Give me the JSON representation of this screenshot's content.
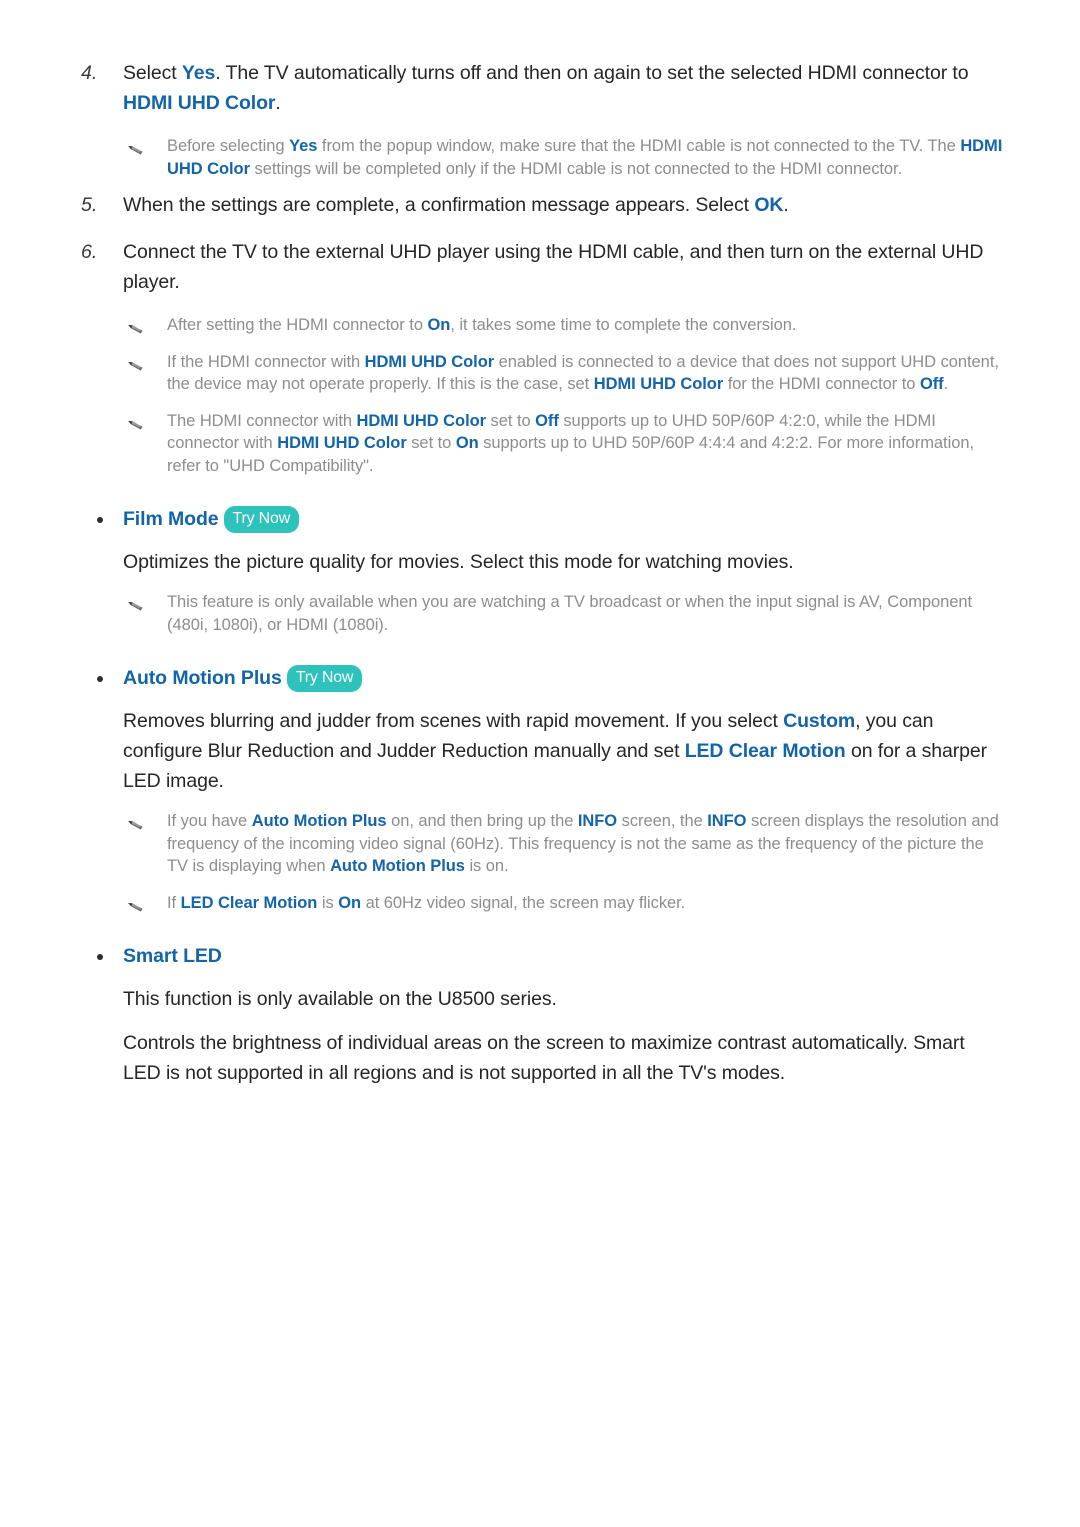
{
  "colors": {
    "link_blue": "#1464aa",
    "note_gray": "#8d8d8d",
    "body_dark": "#262626",
    "try_now_teal": "#2ec2bd"
  },
  "steps": [
    {
      "number": "4.",
      "segments": [
        {
          "t": "Select ",
          "s": "plain"
        },
        {
          "t": "Yes",
          "s": "link"
        },
        {
          "t": ". The TV automatically turns off and then on again to set the selected HDMI connector to ",
          "s": "plain"
        },
        {
          "t": "HDMI UHD Color",
          "s": "link"
        },
        {
          "t": ".",
          "s": "plain"
        }
      ],
      "notes": [
        {
          "icon": "pencil-icon",
          "segments": [
            {
              "t": "Before selecting ",
              "s": "plain"
            },
            {
              "t": "Yes",
              "s": "link"
            },
            {
              "t": " from the popup window, make sure that the HDMI cable is not connected to the TV. The ",
              "s": "plain"
            },
            {
              "t": "HDMI UHD Color",
              "s": "link"
            },
            {
              "t": " settings will be completed only if the HDMI cable is not connected to the HDMI connector.",
              "s": "plain"
            }
          ]
        }
      ]
    },
    {
      "number": "5.",
      "segments": [
        {
          "t": "When the settings are complete, a confirmation message appears. Select ",
          "s": "plain"
        },
        {
          "t": "OK",
          "s": "link"
        },
        {
          "t": ".",
          "s": "plain"
        }
      ],
      "notes": []
    },
    {
      "number": "6.",
      "segments": [
        {
          "t": "Connect the TV to the external UHD player using the HDMI cable, and then turn on the external UHD player.",
          "s": "plain"
        }
      ],
      "notes": [
        {
          "icon": "pencil-icon",
          "segments": [
            {
              "t": "After setting the HDMI connector to ",
              "s": "plain"
            },
            {
              "t": "On",
              "s": "link"
            },
            {
              "t": ", it takes some time to complete the conversion.",
              "s": "plain"
            }
          ]
        },
        {
          "icon": "pencil-icon",
          "segments": [
            {
              "t": "If the HDMI connector with ",
              "s": "plain"
            },
            {
              "t": "HDMI UHD Color",
              "s": "link"
            },
            {
              "t": " enabled is connected to a device that does not support UHD content, the device may not operate properly. If this is the case, set ",
              "s": "plain"
            },
            {
              "t": "HDMI UHD Color",
              "s": "link"
            },
            {
              "t": " for the HDMI connector to ",
              "s": "plain"
            },
            {
              "t": "Off",
              "s": "link"
            },
            {
              "t": ".",
              "s": "plain"
            }
          ]
        },
        {
          "icon": "pencil-icon",
          "segments": [
            {
              "t": "The HDMI connector with ",
              "s": "plain"
            },
            {
              "t": "HDMI UHD Color",
              "s": "link"
            },
            {
              "t": " set to ",
              "s": "plain"
            },
            {
              "t": "Off",
              "s": "link"
            },
            {
              "t": " supports up to UHD 50P/60P 4:2:0, while the HDMI connector with ",
              "s": "plain"
            },
            {
              "t": "HDMI UHD Color",
              "s": "link"
            },
            {
              "t": " set to ",
              "s": "plain"
            },
            {
              "t": "On",
              "s": "link"
            },
            {
              "t": " supports up to UHD 50P/60P 4:4:4 and 4:2:2. For more information, refer to \"UHD Compatibility\".",
              "s": "plain"
            }
          ]
        }
      ]
    }
  ],
  "sections": [
    {
      "title": "Film Mode",
      "badge": "Try Now",
      "has_badge": true,
      "blocks": [
        {
          "kind": "para",
          "segments": [
            {
              "t": "Optimizes the picture quality for movies. Select this mode for watching movies.",
              "s": "plain"
            }
          ]
        },
        {
          "kind": "note",
          "icon": "pencil-icon",
          "segments": [
            {
              "t": "This feature is only available when you are watching a TV broadcast or when the input signal is AV, Component (480i, 1080i), or HDMI (1080i).",
              "s": "plain"
            }
          ]
        }
      ]
    },
    {
      "title": "Auto Motion Plus",
      "badge": "Try Now",
      "has_badge": true,
      "blocks": [
        {
          "kind": "para",
          "segments": [
            {
              "t": "Removes blurring and judder from scenes with rapid movement. If you select ",
              "s": "plain"
            },
            {
              "t": "Custom",
              "s": "link"
            },
            {
              "t": ", you can configure Blur Reduction and Judder Reduction manually and set ",
              "s": "plain"
            },
            {
              "t": "LED Clear Motion",
              "s": "link"
            },
            {
              "t": " on for a sharper LED image.",
              "s": "plain"
            }
          ]
        },
        {
          "kind": "note",
          "icon": "pencil-icon",
          "segments": [
            {
              "t": "If you have ",
              "s": "plain"
            },
            {
              "t": "Auto Motion Plus",
              "s": "link"
            },
            {
              "t": " on, and then bring up the ",
              "s": "plain"
            },
            {
              "t": "INFO",
              "s": "link"
            },
            {
              "t": " screen, the ",
              "s": "plain"
            },
            {
              "t": "INFO",
              "s": "link"
            },
            {
              "t": " screen displays the resolution and frequency of the incoming video signal (60Hz). This frequency is not the same as the frequency of the picture the TV is displaying when ",
              "s": "plain"
            },
            {
              "t": "Auto Motion Plus",
              "s": "link"
            },
            {
              "t": " is on.",
              "s": "plain"
            }
          ]
        },
        {
          "kind": "note",
          "icon": "pencil-icon",
          "segments": [
            {
              "t": "If ",
              "s": "plain"
            },
            {
              "t": "LED Clear Motion",
              "s": "link"
            },
            {
              "t": " is ",
              "s": "plain"
            },
            {
              "t": "On",
              "s": "link"
            },
            {
              "t": " at 60Hz video signal, the screen may flicker.",
              "s": "plain"
            }
          ]
        }
      ]
    },
    {
      "title": "Smart LED",
      "badge": "",
      "has_badge": false,
      "blocks": [
        {
          "kind": "para",
          "segments": [
            {
              "t": "This function is only available on the U8500 series.",
              "s": "plain"
            }
          ]
        },
        {
          "kind": "para",
          "segments": [
            {
              "t": "Controls the brightness of individual areas on the screen to maximize contrast automatically. Smart LED is not supported in all regions and is not supported in all the TV's modes.",
              "s": "plain"
            }
          ]
        }
      ]
    }
  ]
}
